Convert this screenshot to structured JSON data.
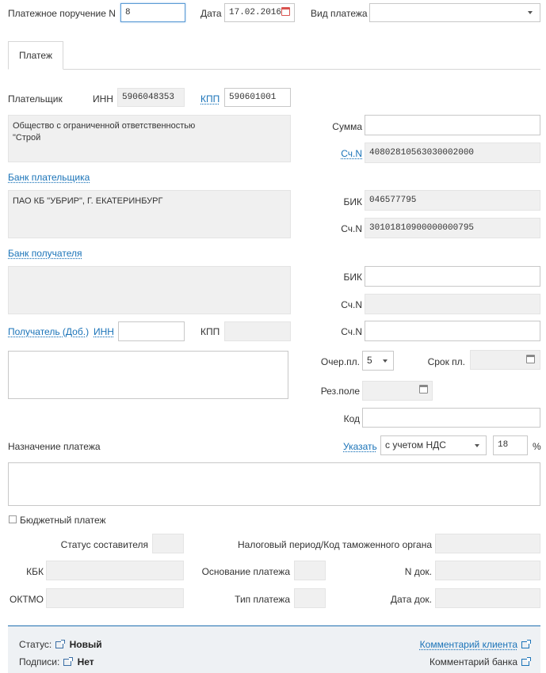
{
  "header": {
    "order_label": "Платежное поручение N",
    "order_value": "8",
    "date_label": "Дата",
    "date_value": "17.02.2016",
    "type_label": "Вид платежа",
    "type_value": ""
  },
  "tabs": [
    {
      "label": "Платеж"
    }
  ],
  "payer": {
    "label": "Плательщик",
    "inn_label": "ИНН",
    "inn_value": "5906048353",
    "kpp_label": "КПП",
    "kpp_value": "590601001",
    "name": "Общество с ограниченной ответственностью\n\"Строй",
    "sum_label": "Сумма",
    "sum_value": "",
    "account_label": "Сч.N",
    "account_value": "40802810563030002000"
  },
  "payer_bank": {
    "label": "Банк плательщика",
    "name": "ПАО КБ \"УБРИР\", Г. ЕКАТЕРИНБУРГ",
    "bik_label": "БИК",
    "bik_value": "046577795",
    "account_label": "Сч.N",
    "account_value": "30101810900000000795"
  },
  "recipient_bank": {
    "label": "Банк получателя",
    "name": "",
    "bik_label": "БИК",
    "bik_value": "",
    "account_label": "Сч.N",
    "account_value": ""
  },
  "recipient": {
    "label": "Получатель (Доб.)",
    "inn_label": "ИНН",
    "inn_value": "",
    "kpp_label": "КПП",
    "kpp_value": "",
    "account_label": "Сч.N",
    "account_value": "",
    "name": "",
    "queue_label": "Очер.пл.",
    "queue_value": "5",
    "term_label": "Срок пл.",
    "term_value": "",
    "reserve_label": "Рез.поле",
    "reserve_value": "",
    "code_label": "Код",
    "code_value": ""
  },
  "purpose": {
    "label": "Назначение платежа",
    "specify_label": "Указать",
    "vat_mode": "с учетом НДС",
    "vat_rate": "18",
    "percent": "%",
    "text": ""
  },
  "budget": {
    "checkbox_label": "Бюджетный платеж",
    "checked": false,
    "status_label": "Статус составителя",
    "status_value": "",
    "tax_period_label": "Налоговый период/Код таможенного органа",
    "tax_period_value": "",
    "kbk_label": "КБК",
    "kbk_value": "",
    "basis_label": "Основание платежа",
    "basis_value": "",
    "doc_no_label": "N док.",
    "doc_no_value": "",
    "oktmo_label": "ОКТМО",
    "oktmo_value": "",
    "pay_type_label": "Тип платежа",
    "pay_type_value": "",
    "doc_date_label": "Дата док.",
    "doc_date_value": ""
  },
  "footer": {
    "status_label": "Статус:",
    "status_value": "Новый",
    "signatures_label": "Подписи:",
    "signatures_value": "Нет",
    "client_comment_label": "Комментарий клиента",
    "bank_comment_label": "Комментарий банка"
  },
  "colors": {
    "link": "#1a73b8",
    "footer_bg": "#eef1f4",
    "footer_border": "#1f6fb0"
  }
}
